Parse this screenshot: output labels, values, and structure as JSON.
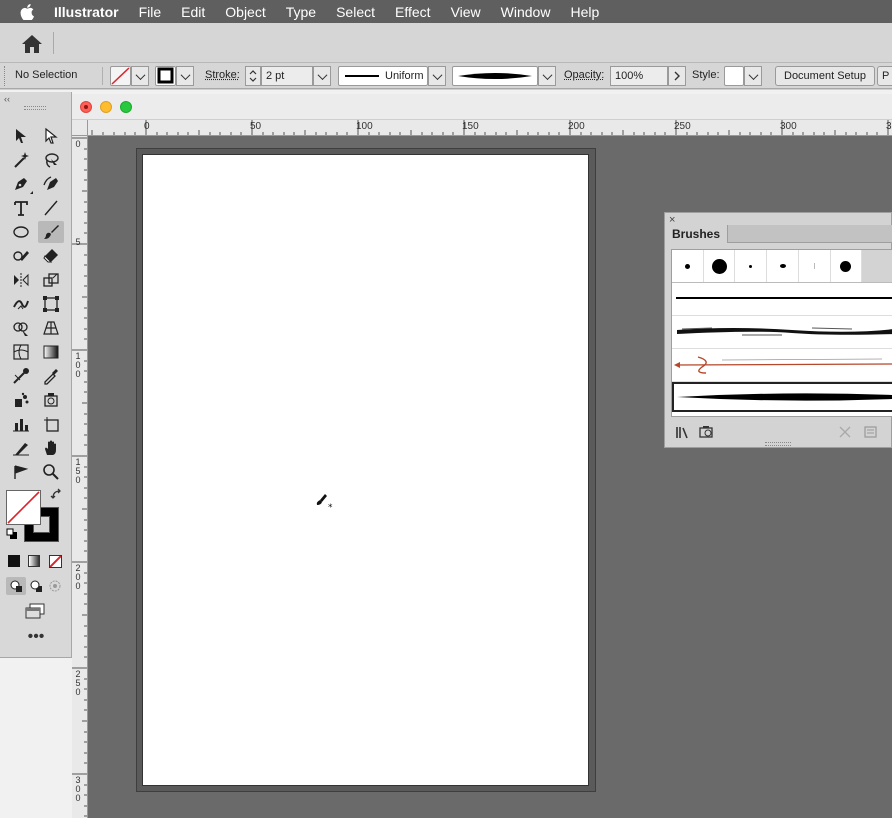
{
  "menubar": {
    "apple_icon": "apple-logo-icon",
    "items": [
      "Illustrator",
      "File",
      "Edit",
      "Object",
      "Type",
      "Select",
      "Effect",
      "View",
      "Window",
      "Help"
    ]
  },
  "appbar": {
    "home_icon": "home-icon"
  },
  "controlbar": {
    "selection_label": "No Selection",
    "stroke_label": "Stroke:",
    "stroke_value": "2 pt",
    "profile_label": "Uniform",
    "opacity_label": "Opacity:",
    "opacity_value": "100%",
    "style_label": "Style:",
    "document_setup": "Document Setup"
  },
  "rulers": {
    "horizontal": [
      "0",
      "50",
      "100",
      "150",
      "200",
      "250",
      "300",
      "3"
    ],
    "vertical": [
      "0",
      "5",
      "100",
      "150",
      "200",
      "250",
      "300"
    ]
  },
  "brushes_panel": {
    "title": "Brushes",
    "close": "×"
  },
  "colors": {
    "menubar_bg": "#5f5f5f",
    "canvas_bg": "#6a6a6a",
    "panel_bg": "#d8d8d8",
    "none_swatch_red": "#d9252c",
    "brush_accent": "#b5472a"
  }
}
